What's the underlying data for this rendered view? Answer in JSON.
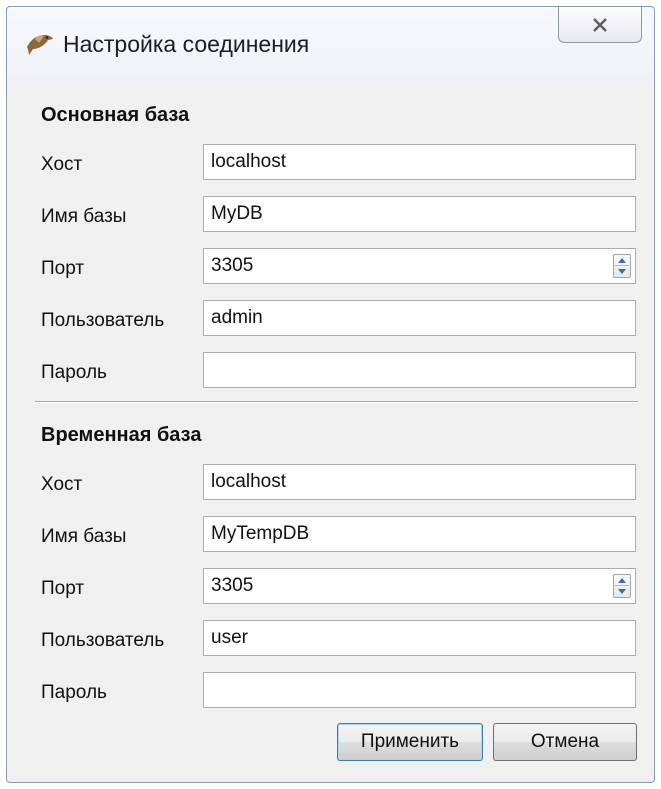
{
  "window": {
    "title": "Настройка соединения"
  },
  "primary": {
    "title": "Основная база",
    "host_label": "Хост",
    "host_value": "localhost",
    "db_label": "Имя базы",
    "db_value": "MyDB",
    "port_label": "Порт",
    "port_value": "3305",
    "user_label": "Пользователь",
    "user_value": "admin",
    "password_label": "Пароль",
    "password_value": ""
  },
  "temporary": {
    "title": "Временная база",
    "host_label": "Хост",
    "host_value": "localhost",
    "db_label": "Имя базы",
    "db_value": "MyTempDB",
    "port_label": "Порт",
    "port_value": "3305",
    "user_label": "Пользователь",
    "user_value": "user",
    "password_label": "Пароль",
    "password_value": ""
  },
  "buttons": {
    "apply": "Применить",
    "cancel": "Отмена"
  },
  "icons": {
    "app": "bird-icon",
    "close": "close-icon",
    "spin": "spinner-arrows-icon"
  }
}
